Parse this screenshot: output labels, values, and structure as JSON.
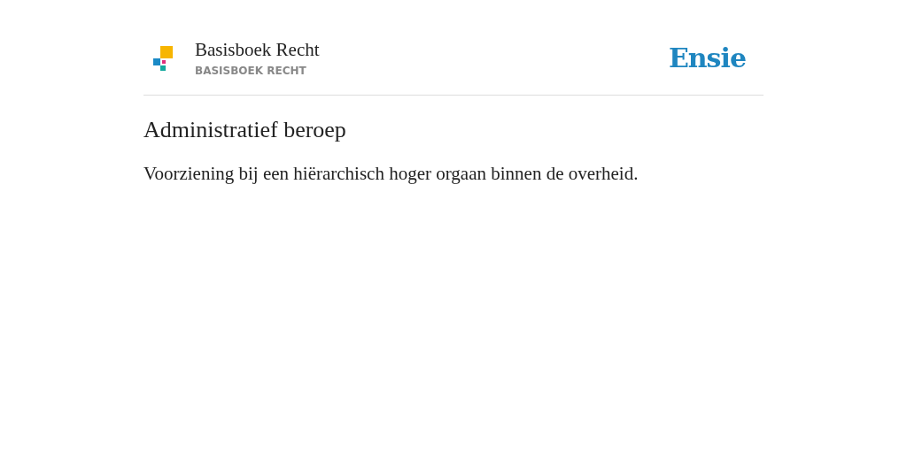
{
  "header": {
    "title": "Basisboek Recht",
    "subtitle": "BASISBOEK RECHT",
    "brand": "Ensie"
  },
  "entry": {
    "term": "Administratief beroep",
    "definition": "Voorziening bij een hiërarchisch hoger orgaan binnen de overheid."
  }
}
